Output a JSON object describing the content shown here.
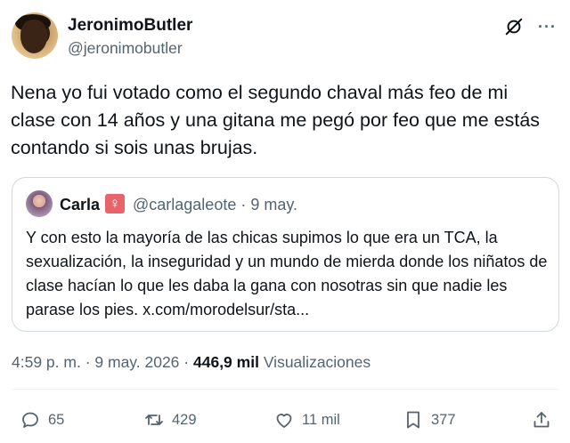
{
  "author": {
    "name": "JeronimoButler",
    "handle": "@jeronimobutler"
  },
  "tweet": {
    "text": "Nena yo fui votado como el segundo chaval más feo de mi clase con 14 años y una gitana me pegó por feo que me estás contando si sois unas brujas."
  },
  "quoted": {
    "name": "Carla",
    "badge": "♀",
    "handle": "@carlagaleote",
    "separator": "·",
    "date": "9 may.",
    "text": "Y con esto la mayoría de las chicas supimos lo que era un TCA, la sexualización, la inseguridad y un mundo de mierda donde los niñatos de clase hacían lo que les daba la gana con nosotras sin que nadie les parase los pies. x.com/morodelsur/sta..."
  },
  "meta": {
    "time": "4:59 p. m.",
    "sep1": "·",
    "date": "9 may. 2026",
    "sep2": "·",
    "views_count": "446,9 mil",
    "views_label": "Visualizaciones"
  },
  "actions": {
    "replies": "65",
    "reposts": "429",
    "likes": "11 mil",
    "bookmarks": "377"
  },
  "icons": [
    "grok-icon",
    "more-icon",
    "reply-icon",
    "repost-icon",
    "like-icon",
    "bookmark-icon",
    "share-icon"
  ],
  "colors": {
    "text": "#0f1419",
    "secondary": "#536471",
    "border": "#cfd9de",
    "badge": "#e8646c"
  }
}
